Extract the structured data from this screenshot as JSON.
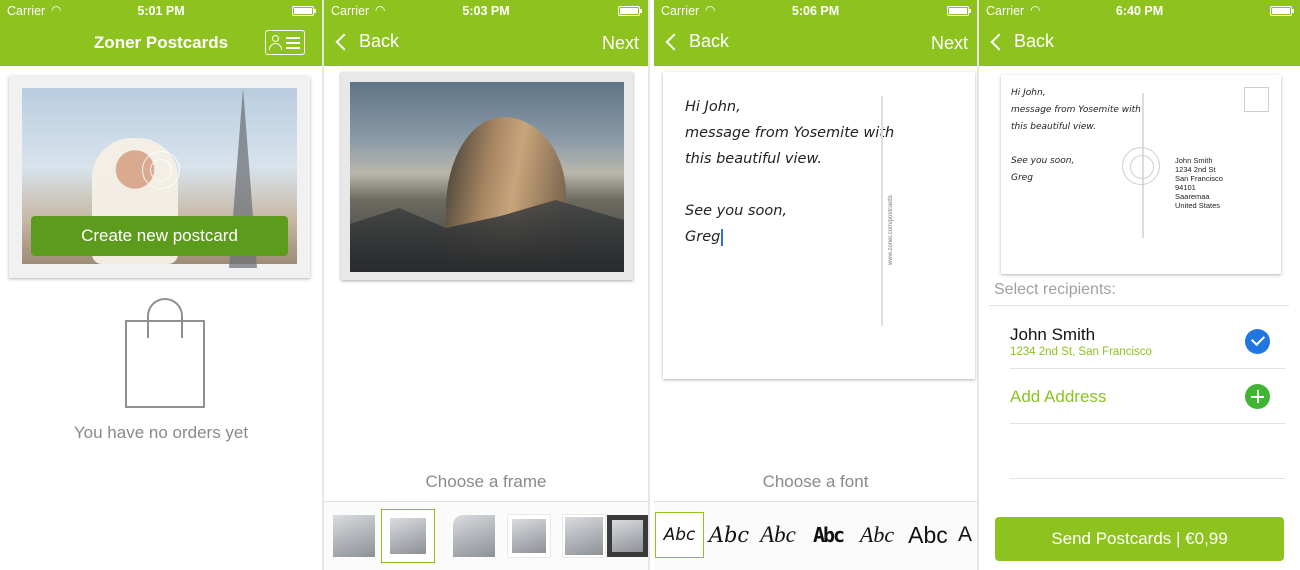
{
  "screens": {
    "home": {
      "status": {
        "carrier": "Carrier",
        "time": "5:01 PM"
      },
      "title": "Zoner Postcards",
      "create_button": "Create new postcard",
      "empty_text": "You have no orders yet"
    },
    "frame": {
      "status": {
        "carrier": "Carrier",
        "time": "5:03 PM"
      },
      "back": "Back",
      "next": "Next",
      "choose_label": "Choose a frame"
    },
    "font": {
      "status": {
        "carrier": "Carrier",
        "time": "5:06 PM"
      },
      "back": "Back",
      "next": "Next",
      "message_lines": [
        "Hi John,",
        "message from Yosemite with",
        "this beautiful view.",
        "",
        "See you soon,",
        "Greg"
      ],
      "website": "www.zoner.com/postcards",
      "choose_label": "Choose a font",
      "font_samples": [
        "Abc",
        "Abc",
        "Abc",
        "Abc",
        "Abc",
        "Abc",
        "A"
      ]
    },
    "send": {
      "status": {
        "carrier": "Carrier",
        "time": "6:40 PM"
      },
      "back": "Back",
      "preview_message": [
        "Hi John,",
        "message from Yosemite with",
        "this beautiful view.",
        "",
        "See you soon,",
        "Greg"
      ],
      "preview_address": [
        "John Smith",
        "1234 2nd St",
        "San Francisco",
        "94101",
        "Saaremaa",
        "United States"
      ],
      "select_label": "Select recipients:",
      "recipient": {
        "name": "John Smith",
        "address": "1234 2nd St, San Francisco"
      },
      "add_address": "Add Address",
      "send_button": "Send Postcards | €0,99"
    }
  },
  "colors": {
    "accent": "#8dc21f",
    "button_dark": "#5d9b1d",
    "check_blue": "#2176e0",
    "add_green": "#3fb533"
  }
}
